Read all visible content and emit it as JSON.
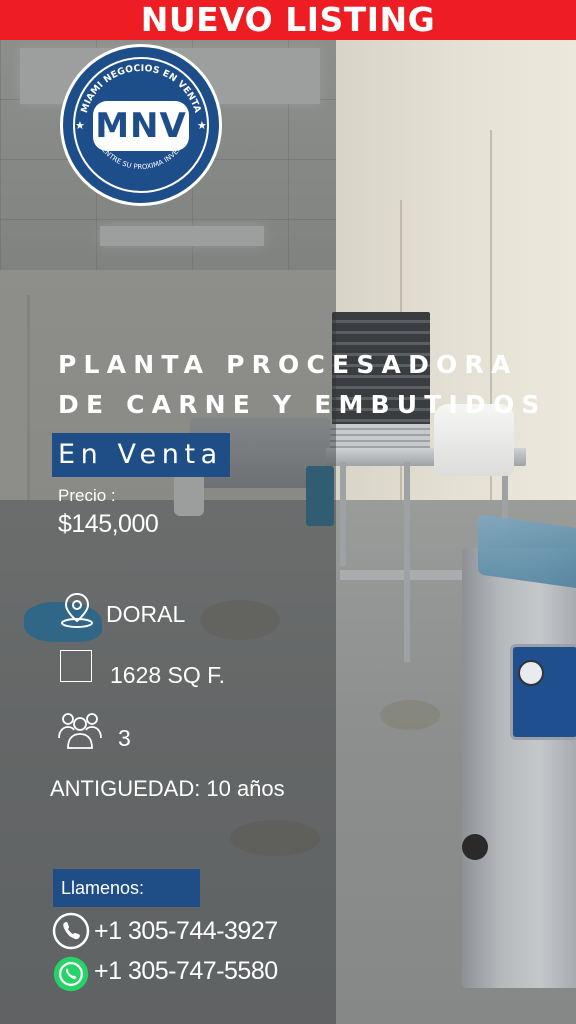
{
  "banner": {
    "title": "NUEVO LISTING",
    "color": "#ee1d23"
  },
  "logo": {
    "arc_top": "MIAMI NEGOCIOS EN VENTA",
    "mark": "MNV",
    "arc_bottom": "ENCUENTRE SU PROXIMA INVERSION"
  },
  "listing": {
    "title_line1": "PLANTA PROCESADORA",
    "title_line2": "DE CARNE Y EMBUTIDOS",
    "status": "En Venta",
    "price_label": "Precio :",
    "price": "$145,000",
    "location": "DORAL",
    "area": "1628 SQ F.",
    "employees": "3",
    "age_label": "ANTIGUEDAD:",
    "age_value": "10 años"
  },
  "contact": {
    "label": "Llamenos:",
    "phone_1": "+1 305-744-3927",
    "phone_2": "+1 305-747-5580"
  },
  "icons": {
    "location": "location-pin-icon",
    "area": "square-area-icon",
    "employees": "people-group-icon",
    "phone": "phone-icon",
    "whatsapp": "whatsapp-icon"
  },
  "colors": {
    "accent_blue": "#1f4e87",
    "logo_blue": "#1e4e8a",
    "whatsapp_green": "#25d366"
  }
}
